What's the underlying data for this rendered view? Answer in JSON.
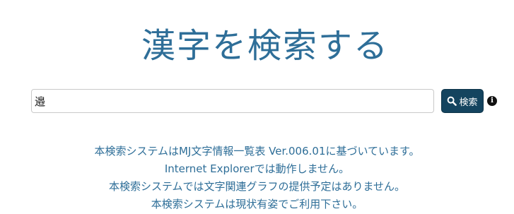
{
  "header": {
    "title": "漢字を検索する"
  },
  "search": {
    "value": "邉",
    "button_label": "検索",
    "search_icon": "search-icon",
    "info_icon": "info-icon"
  },
  "notes": [
    "本検索システムはMJ文字情報一覧表 Ver.006.01に基づいています。",
    "Internet Explorerでは動作しません。",
    "本検索システムでは文字関連グラフの提供予定はありません。",
    "本検索システムは現状有姿でご利用下さい。"
  ],
  "colors": {
    "accent": "#2e6e98",
    "button": "#14445f"
  }
}
